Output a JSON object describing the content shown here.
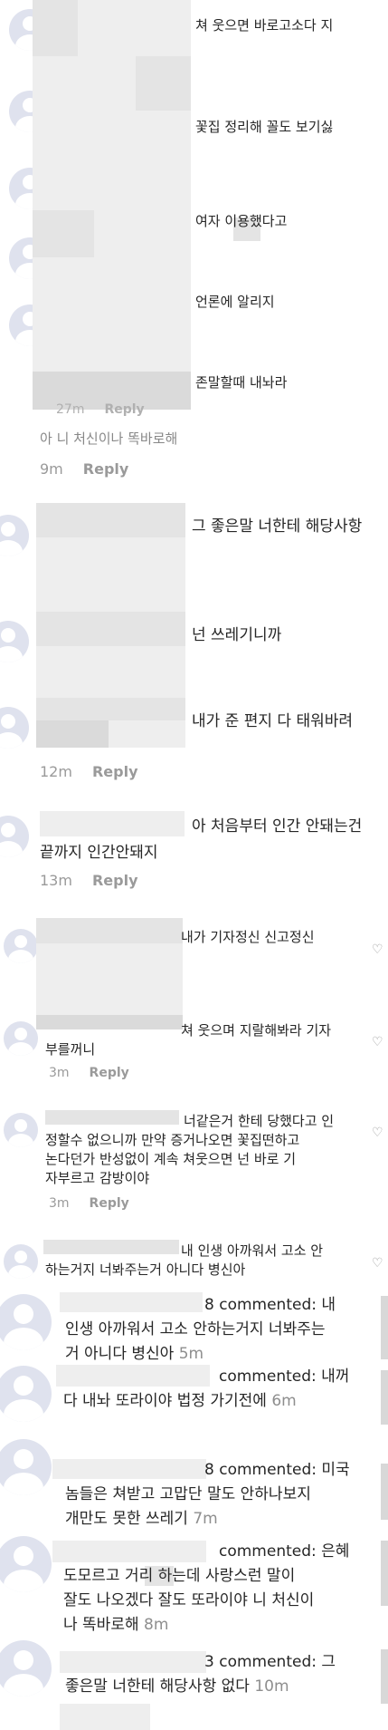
{
  "comments_a": [
    {
      "text": "쳐 웃으면 바로고소다 지"
    },
    {
      "text": "꽃집 정리해 꼴도 보기싫"
    },
    {
      "text": "여자 이용했다고"
    },
    {
      "text": "언론에 알리지"
    },
    {
      "text": "존말할때 내놔라"
    }
  ],
  "partial_meta": {
    "time": "27m",
    "reply": "Reply"
  },
  "partial_line": "아 니 처신이나 똑바로해",
  "meta_9m": {
    "time": "9m",
    "reply": "Reply"
  },
  "comments_b": [
    {
      "text": "그 좋은말 너한테 해당사항"
    },
    {
      "text": "넌 쓰레기니까"
    },
    {
      "text": "내가 준 편지 다 태워바려"
    }
  ],
  "meta_12m": {
    "time": "12m",
    "reply": "Reply"
  },
  "comment_c": {
    "line1": "아 처음부터 인간 안돼는건",
    "line2": "끝까지 인간안돼지"
  },
  "meta_13m": {
    "time": "13m",
    "reply": "Reply"
  },
  "comments_d": [
    {
      "text": "내가 기자정신 신고정신"
    },
    {
      "line1": "쳐 웃으며 지랄해봐라 기자",
      "line2": "부를꺼니"
    },
    {
      "line1": "너같은거 한테 당했다고 인",
      "line2": "정할수 없으니까 만약 증거나오면 꽃집떤하고",
      "line3": "논다던가 반성없이 계속 쳐웃으면 넌 바로 기",
      "line4": "자부르고 감방이야"
    },
    {
      "line1": "내 인생 아까워서 고소 안",
      "line2": "하는거지 너봐주는거 아니다 병신아"
    }
  ],
  "meta_3m_a": {
    "time": "3m",
    "reply": "Reply"
  },
  "meta_3m_b": {
    "time": "3m",
    "reply": "Reply"
  },
  "notifications": [
    {
      "line1": "8 commented: 내",
      "line2": "인생 아까워서 고소 안하는거지 너봐주는",
      "line3": "거 아니다 병신아",
      "time": "5m"
    },
    {
      "line1": "commented: 내꺼",
      "line2": "다 내놔 또라이야 법정 가기전에",
      "time": "6m"
    },
    {
      "line1": "8 commented: 미국",
      "line2": "놈들은 쳐받고 고맙단 말도 안하나보지",
      "line3": "개만도 못한 쓰레기",
      "time": "7m"
    },
    {
      "line1": "commented: 은혜",
      "line2": "도모르고 거리 하는데 사랑스런 말이",
      "line3": "잘도 나오겠다 잘도 또라이야 니 처신이",
      "line4": "나 똑바로해",
      "time": "8m"
    },
    {
      "line1": "3 commented: 그",
      "line2": "좋은말 너한테 해당사항 없다",
      "time": "10m"
    }
  ]
}
